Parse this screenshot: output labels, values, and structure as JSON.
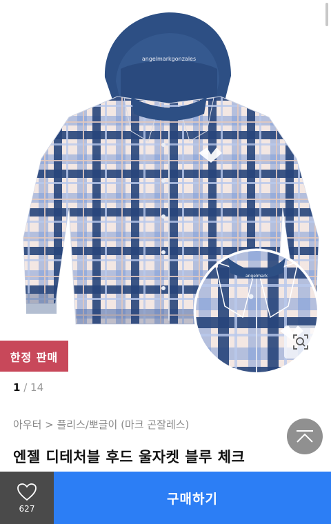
{
  "product": {
    "badge": "한정 판매",
    "pager": {
      "current": "1",
      "separator": " / ",
      "total": "14"
    },
    "breadcrumb": "아우터 > 플리스/뽀글이 (마크 곤잘레스)",
    "title": "엔젤 디테처블 후드 울자켓 블루 체크"
  },
  "bottom_bar": {
    "like_count": "627",
    "buy_label": "구매하기"
  },
  "colors": {
    "badge_bg": "#c8485a",
    "buy_bg": "#2c7ef5",
    "like_bg": "#4a4a4a",
    "hood": "#2d4f84",
    "plaid_dark": "#26457a",
    "plaid_light": "#f4e9e4"
  },
  "icons": {
    "zoom": "search-zoom-icon",
    "like": "heart-outline-icon",
    "scroll_top": "chevron-up-icon"
  }
}
